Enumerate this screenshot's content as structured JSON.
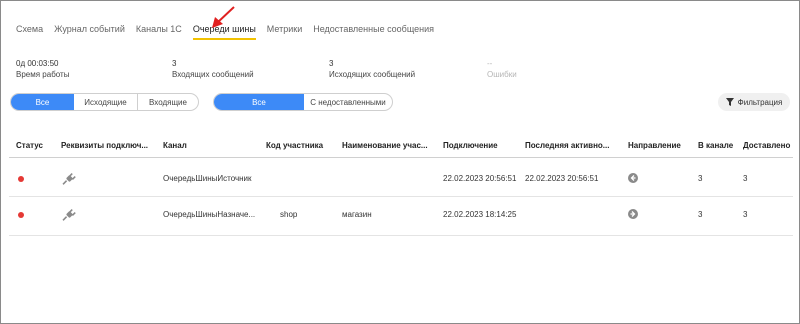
{
  "tabs": [
    "Схема",
    "Журнал событий",
    "Каналы 1С",
    "Очереди шины",
    "Метрики",
    "Недоставленные сообщения"
  ],
  "active_tab": "Очереди шины",
  "stats": {
    "uptime_value": "0д 00:03:50",
    "uptime_label": "Время работы",
    "incoming_value": "3",
    "incoming_label": "Входящих сообщений",
    "outgoing_value": "3",
    "outgoing_label": "Исходящих сообщений",
    "errors_value": "--",
    "errors_label": "Ошибки"
  },
  "direction_filter": {
    "all": "Все",
    "outgoing": "Исходящие",
    "incoming": "Входящие"
  },
  "delivery_filter": {
    "all": "Все",
    "undelivered": "С недоставленными"
  },
  "filter_button": "Фильтрация",
  "table": {
    "headers": [
      "Статус",
      "Реквизиты подключ...",
      "Канал",
      "Код участника",
      "Наименование учас...",
      "Подключение",
      "Последняя активно...",
      "Направление",
      "В канале",
      "Доставлено"
    ],
    "rows": [
      {
        "status": "error",
        "channel": "ОчередьШиныИсточник",
        "participant_code": "",
        "participant_name": "",
        "connected": "22.02.2023 20:56:51",
        "last_activity": "22.02.2023 20:56:51",
        "direction": "incoming",
        "in_channel": "3",
        "delivered": "3"
      },
      {
        "status": "error",
        "channel": "ОчередьШиныНазначе...",
        "participant_code": "shop",
        "participant_name": "магазин",
        "connected": "22.02.2023 18:14:25",
        "last_activity": "",
        "direction": "outgoing",
        "in_channel": "3",
        "delivered": "3"
      }
    ]
  },
  "colors": {
    "accent": "#3d8af7",
    "tab_underline": "#f2c200",
    "status_error": "#e53935",
    "arrow": "#e02020"
  }
}
